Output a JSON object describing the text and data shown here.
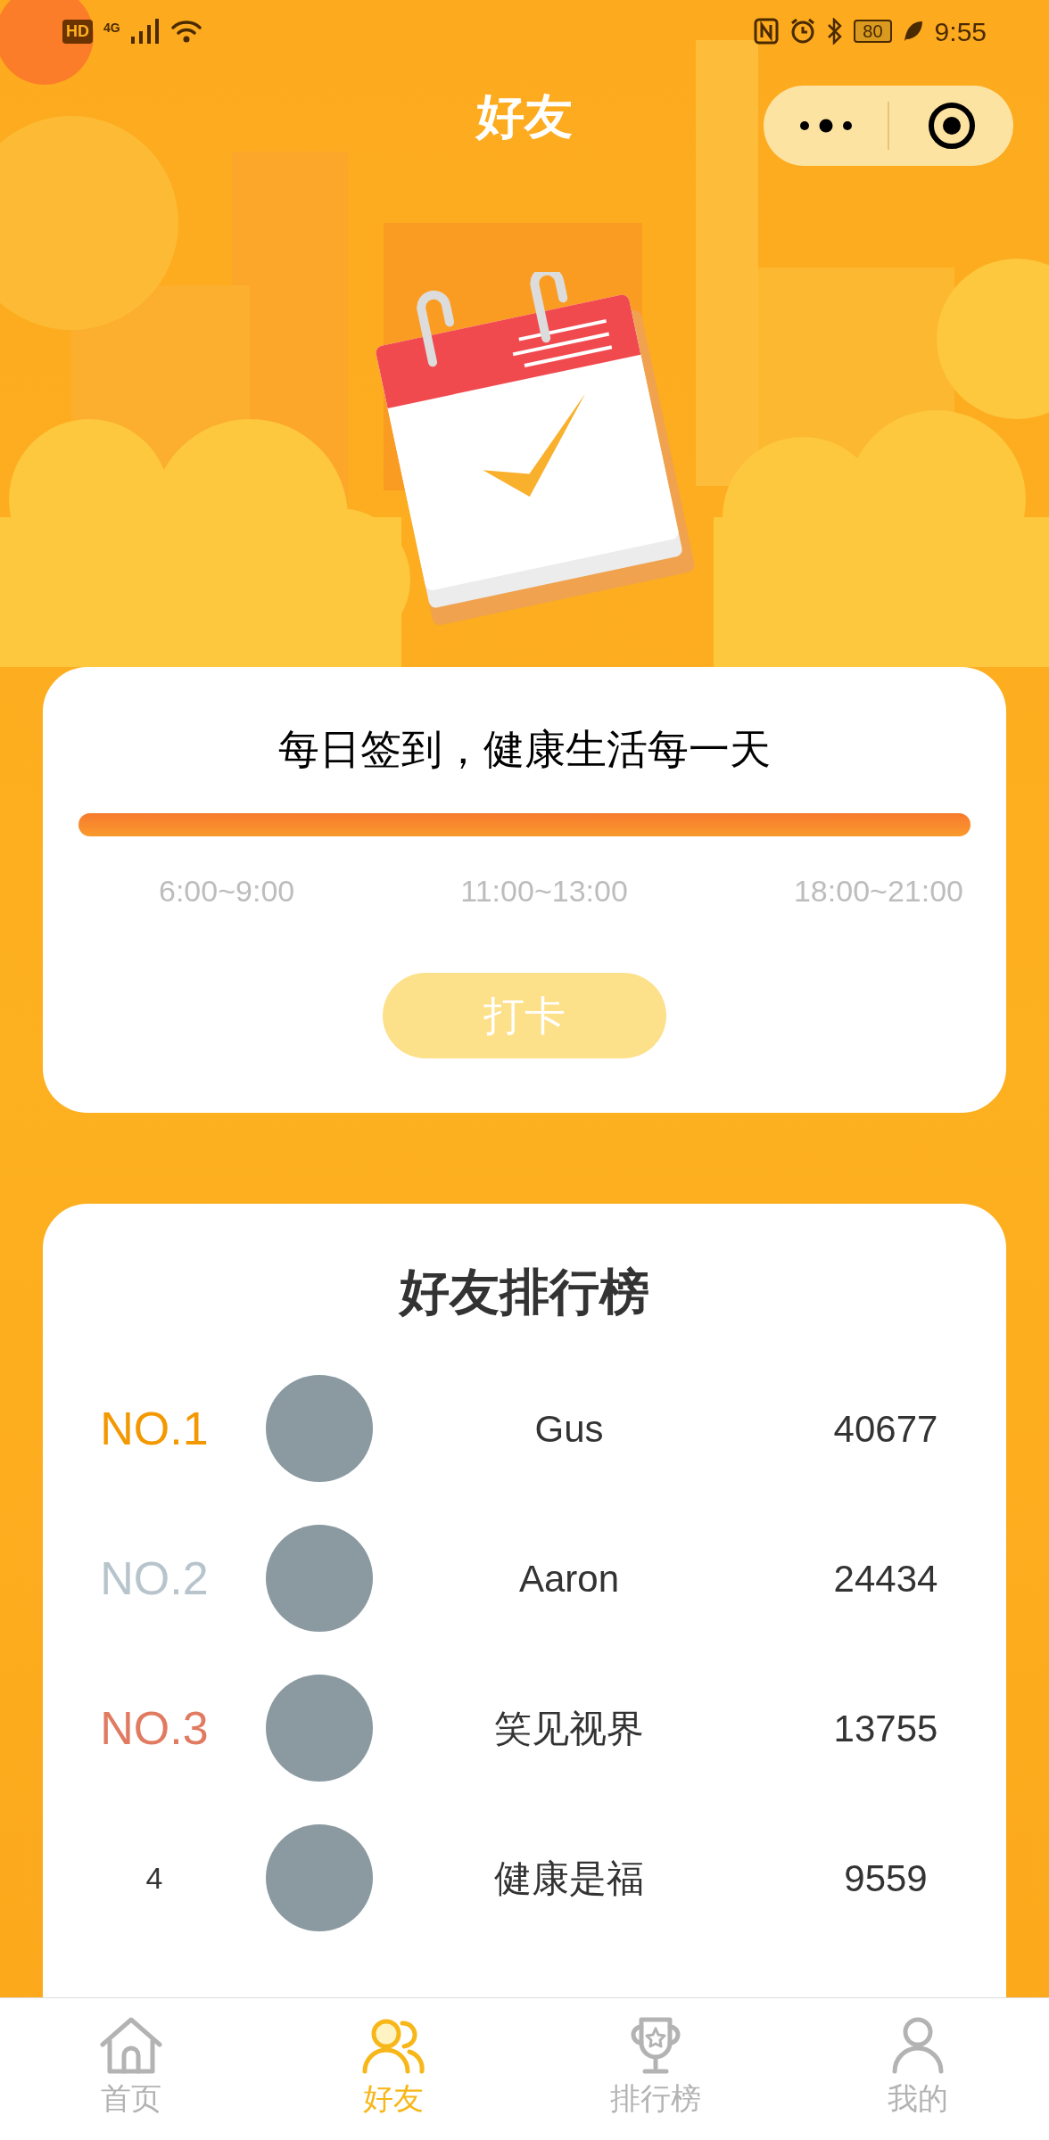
{
  "status_bar": {
    "hd": "HD",
    "network": "4G",
    "battery": "80",
    "time": "9:55"
  },
  "nav_bar": {
    "title": "好友"
  },
  "checkin_card": {
    "title": "每日签到，健康生活每一天",
    "progress": {
      "level": 1
    },
    "time_slots": [
      "6:00~9:00",
      "11:00~13:00",
      "18:00~21:00"
    ],
    "button": {
      "label": "打卡",
      "disabled": true
    }
  },
  "ranking": {
    "title": "好友排行榜",
    "rows": [
      {
        "rank": "NO.1",
        "color": "#f39800",
        "name": "Gus",
        "score": "40677"
      },
      {
        "rank": "NO.2",
        "color": "#b8c4cc",
        "name": "Aaron",
        "score": "24434"
      },
      {
        "rank": "NO.3",
        "color": "#e07b62",
        "name": "笑见视界",
        "score": "13755"
      },
      {
        "rank": "4",
        "color": "#333333",
        "name": "健康是福",
        "score": "9559"
      }
    ]
  },
  "tab_bar": [
    {
      "label": "首页",
      "selected": false,
      "kind": "home"
    },
    {
      "label": "好友",
      "selected": true,
      "kind": "friends"
    },
    {
      "label": "排行榜",
      "selected": false,
      "kind": "trophy"
    },
    {
      "label": "我的",
      "selected": false,
      "kind": "person"
    }
  ]
}
